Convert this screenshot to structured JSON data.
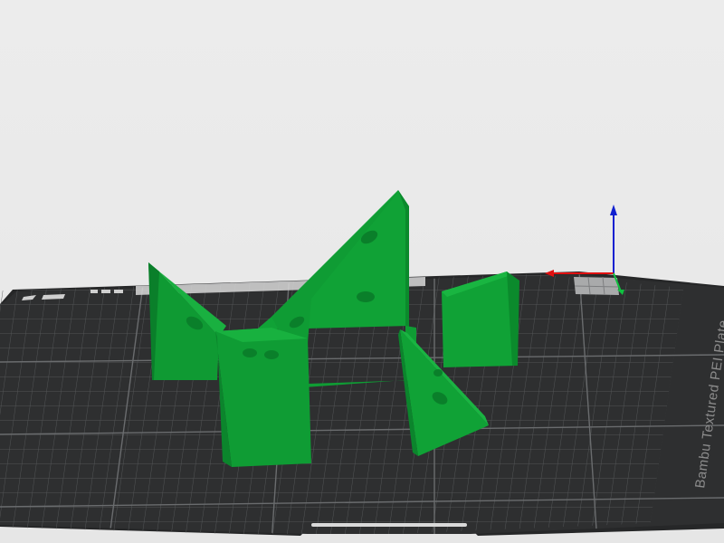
{
  "app": {
    "view": "3d-prepare-viewport"
  },
  "plate": {
    "label": "Bambu Textured PEI Plate",
    "surface_color": "#2e2f30",
    "grid_color": "#5a5c5e"
  },
  "model": {
    "color": "#0e9b34",
    "parts": [
      "triangle-bracket-left",
      "tall-triangle-center",
      "block-front",
      "wedge-right-back",
      "small-triangle-right"
    ]
  },
  "axes": {
    "x_color": "#e01010",
    "y_color": "#10c040",
    "z_color": "#1020d0"
  },
  "icons": [
    "plate-logo-icon",
    "plate-status-icon",
    "axis-gizmo-icon"
  ]
}
